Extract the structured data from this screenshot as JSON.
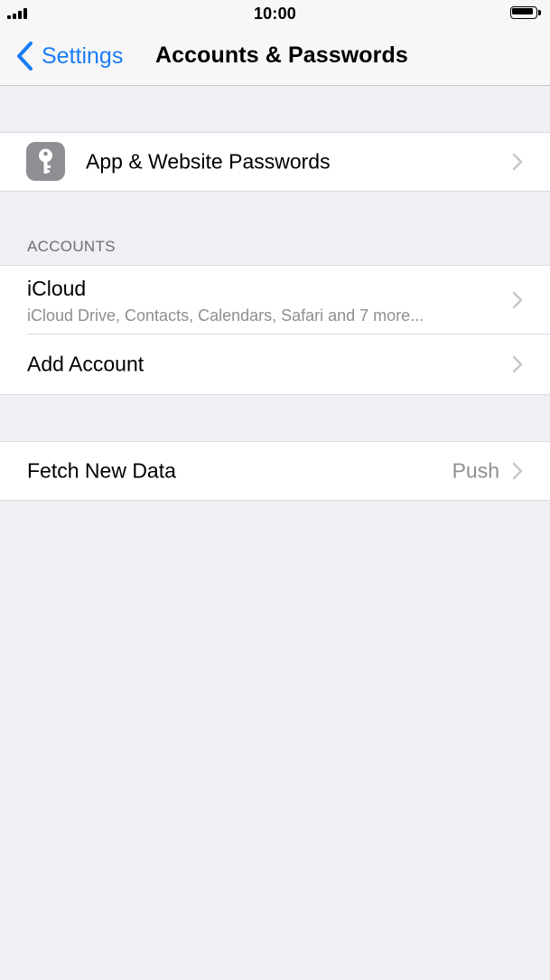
{
  "status_bar": {
    "time": "10:00"
  },
  "nav": {
    "back_label": "Settings",
    "title": "Accounts & Passwords"
  },
  "passwords_row": {
    "label": "App & Website Passwords",
    "icon": "key-icon"
  },
  "accounts_section": {
    "header": "ACCOUNTS",
    "icloud": {
      "title": "iCloud",
      "subtitle": "iCloud Drive, Contacts, Calendars, Safari and 7 more..."
    },
    "add_account": {
      "label": "Add Account"
    }
  },
  "fetch_row": {
    "label": "Fetch New Data",
    "value": "Push"
  },
  "colors": {
    "accent": "#1a7cf5",
    "background": "#efeff4",
    "secondary_text": "#8e8e93"
  }
}
